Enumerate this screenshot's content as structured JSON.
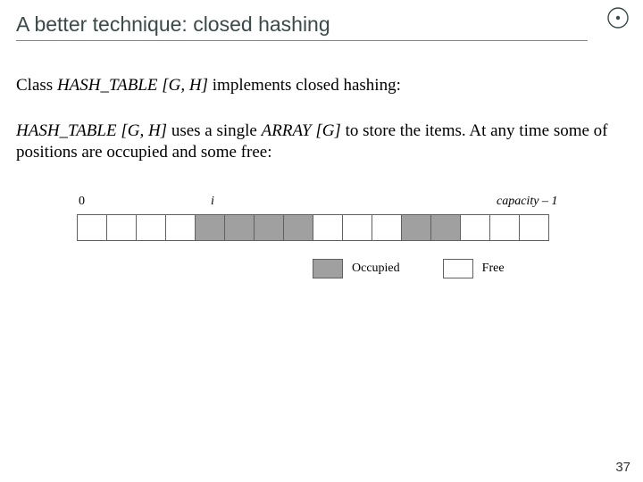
{
  "title": "A better technique: closed hashing",
  "line1": {
    "prefix": "Class ",
    "className": "HASH_TABLE [G, H]",
    "suffix": " implements closed hashing:"
  },
  "line2": {
    "s1": "HASH_TABLE [G, H]",
    "s2": " uses a single ",
    "s3": "ARRAY [G]",
    "s4": " to store the items. At any time some of positions are occupied and some free:"
  },
  "diagram": {
    "labels": {
      "zero": "0",
      "i": "i",
      "capacity": "capacity – 1"
    },
    "cells": [
      "free",
      "free",
      "free",
      "free",
      "occ",
      "occ",
      "occ",
      "occ",
      "free",
      "free",
      "free",
      "occ",
      "occ",
      "free",
      "free",
      "free"
    ]
  },
  "legend": {
    "occupied": "Occupied",
    "free": "Free"
  },
  "pageNumber": "37"
}
